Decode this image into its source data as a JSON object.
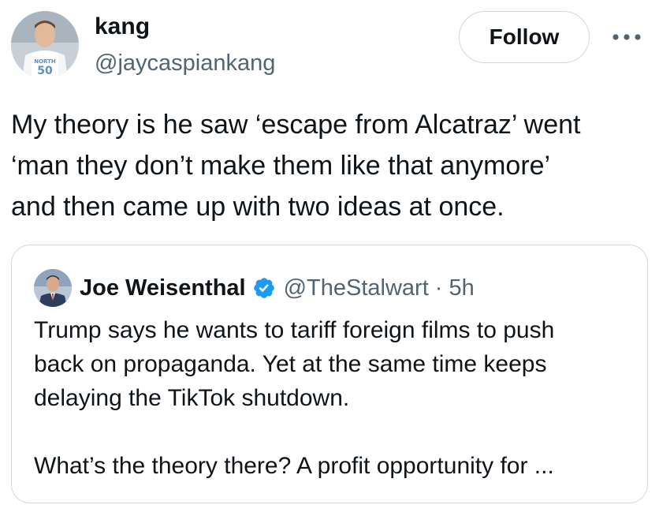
{
  "author": {
    "name": "kang",
    "handle": "@jaycaspiankang"
  },
  "actions": {
    "follow_label": "Follow",
    "more_icon": "more-horizontal-icon"
  },
  "tweet": {
    "text": "My theory is he saw ‘escape from Alcatraz’ went\n‘man they don’t make them like that anymore’\nand then came up with two ideas at once."
  },
  "quote": {
    "name": "Joe Weisenthal",
    "verified_icon": "verified-badge-icon",
    "handle": "@TheStalwart",
    "separator": "·",
    "time": "5h",
    "text": "Trump says he wants to tariff foreign films to push\nback on propaganda. Yet at the same time keeps\ndelaying the TikTok shutdown.\n\nWhat’s the theory there? A profit opportunity for ..."
  },
  "colors": {
    "text": "#0f1419",
    "secondary": "#536471",
    "border": "#cfd9de",
    "verified": "#1d9bf0"
  }
}
